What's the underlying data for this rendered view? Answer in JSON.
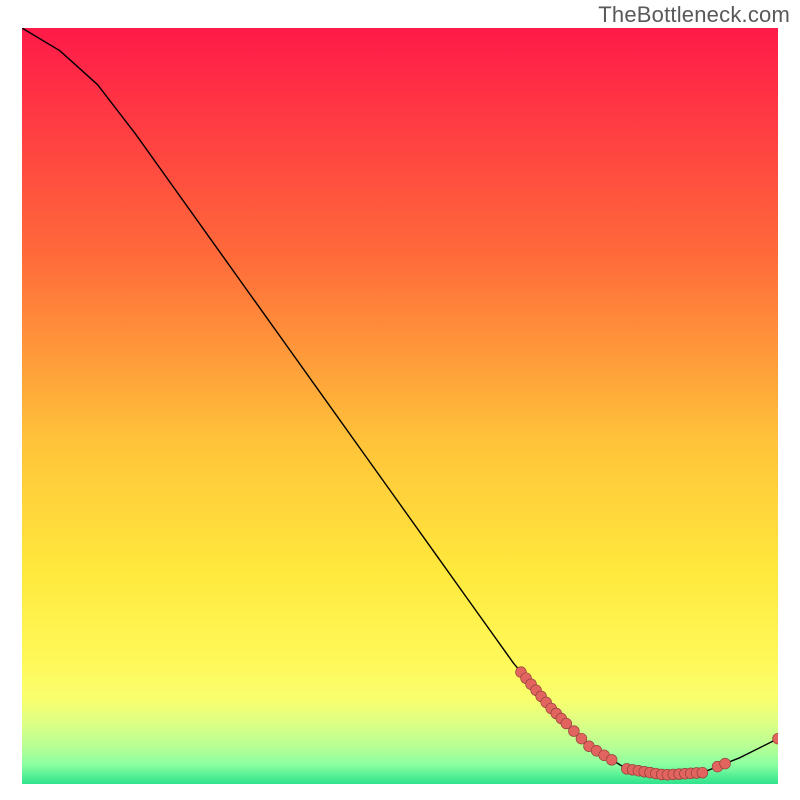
{
  "watermark": "TheBottleneck.com",
  "colors": {
    "gradient_top": "#ff1a49",
    "gradient_mid1": "#ff6a3a",
    "gradient_mid2": "#ffc43a",
    "gradient_mid3": "#ffe93d",
    "gradient_mid4": "#fff95a",
    "gradient_band1": "#f8ff6e",
    "gradient_band2": "#dcff85",
    "gradient_band3": "#b8ff94",
    "gradient_band4": "#8affa0",
    "gradient_bottom": "#2fe38d",
    "curve": "#000000",
    "marker_fill": "#e2645f",
    "marker_stroke": "#8b3a36"
  },
  "chart_data": {
    "type": "line",
    "title": "",
    "xlabel": "",
    "ylabel": "",
    "xlim": [
      0,
      100
    ],
    "ylim": [
      0,
      100
    ],
    "curve": [
      {
        "x": 0,
        "y": 100
      },
      {
        "x": 5,
        "y": 97
      },
      {
        "x": 10,
        "y": 92.5
      },
      {
        "x": 15,
        "y": 86
      },
      {
        "x": 20,
        "y": 79
      },
      {
        "x": 25,
        "y": 72
      },
      {
        "x": 30,
        "y": 65
      },
      {
        "x": 35,
        "y": 58
      },
      {
        "x": 40,
        "y": 51
      },
      {
        "x": 45,
        "y": 44
      },
      {
        "x": 50,
        "y": 37
      },
      {
        "x": 55,
        "y": 30
      },
      {
        "x": 60,
        "y": 23
      },
      {
        "x": 65,
        "y": 16
      },
      {
        "x": 70,
        "y": 10
      },
      {
        "x": 75,
        "y": 5
      },
      {
        "x": 80,
        "y": 2
      },
      {
        "x": 85,
        "y": 1.2
      },
      {
        "x": 90,
        "y": 1.5
      },
      {
        "x": 95,
        "y": 3.5
      },
      {
        "x": 100,
        "y": 6
      }
    ],
    "marker_clusters": [
      {
        "start_x": 66,
        "end_x": 72,
        "count": 10,
        "y_from": 15,
        "y_to": 8
      },
      {
        "start_x": 73,
        "end_x": 78,
        "count": 6,
        "y_from": 7,
        "y_to": 3
      },
      {
        "start_x": 80,
        "end_x": 90,
        "count": 14,
        "y_from": 2,
        "y_to": 1.2
      },
      {
        "start_x": 92,
        "end_x": 93,
        "count": 2,
        "y_from": 2,
        "y_to": 2.3
      }
    ],
    "end_marker": {
      "x": 100,
      "y": 6
    }
  }
}
